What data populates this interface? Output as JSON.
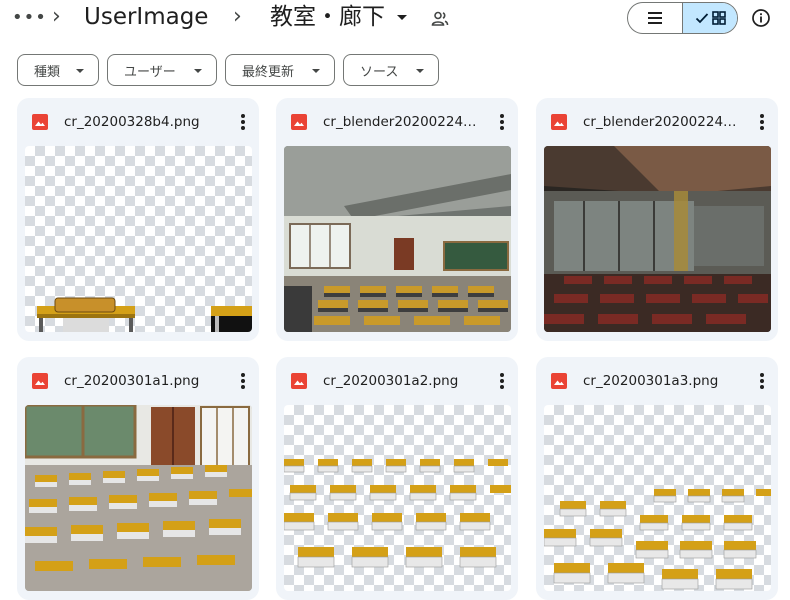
{
  "breadcrumb": {
    "more": "•••",
    "separator": "›",
    "items": [
      "UserImage",
      "教室・廊下"
    ]
  },
  "icons": {
    "more": "more-horiz-icon",
    "share": "shared-folder-icon",
    "list_view": "list-view-icon",
    "grid_view": "grid-view-icon",
    "check": "check-icon",
    "info": "info-icon",
    "file_type": "image-file-icon",
    "menu": "more-vert-icon"
  },
  "view": {
    "selected": "grid"
  },
  "filters": [
    {
      "label": "種類"
    },
    {
      "label": "ユーザー"
    },
    {
      "label": "最終更新"
    },
    {
      "label": "ソース"
    }
  ],
  "files": [
    {
      "name": "cr_20200328b4.png"
    },
    {
      "name": "cr_blender20200224…"
    },
    {
      "name": "cr_blender20200224…"
    },
    {
      "name": "cr_20200301a1.png"
    },
    {
      "name": "cr_20200301a2.png"
    },
    {
      "name": "cr_20200301a3.png"
    }
  ],
  "colors": {
    "card_bg": "#f0f4f9",
    "selected_toggle": "#c2e7ff",
    "image_icon": "#ea4335",
    "desk_top": "#d4a017",
    "desk_frame": "#5a5a5a"
  }
}
